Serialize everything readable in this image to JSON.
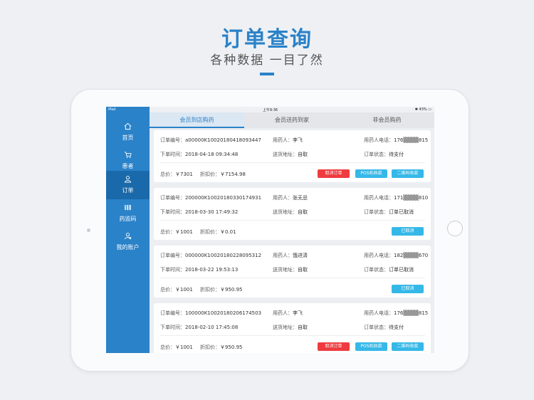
{
  "promo": {
    "title": "订单查询",
    "subtitle": "各种数据 一目了然"
  },
  "statusbar": {
    "device": "iPad",
    "time": "上午9:36",
    "battery": "43%"
  },
  "sidebar": {
    "items": [
      {
        "label": "首页",
        "icon": "home-icon",
        "active": false
      },
      {
        "label": "患者",
        "icon": "cart-icon",
        "active": false
      },
      {
        "label": "订单",
        "icon": "user-icon",
        "active": true
      },
      {
        "label": "药监码",
        "icon": "barcode-icon",
        "active": false
      },
      {
        "label": "我的账户",
        "icon": "account-icon",
        "active": false
      }
    ]
  },
  "tabs": [
    {
      "label": "会员到店购药",
      "active": true
    },
    {
      "label": "会员送药到家",
      "active": false
    },
    {
      "label": "非会员购药",
      "active": false
    }
  ],
  "labels": {
    "order_no": "订单编号：",
    "user": "用药人：",
    "phone": "用药人电话：",
    "time": "下单时间：",
    "address": "送货地址：",
    "status": "订单状态：",
    "total": "总价：",
    "discount": "折扣价："
  },
  "orders": [
    {
      "order_no": "a00000K10020180418093447",
      "user": "李飞",
      "phone": "176▒▒▒▒815",
      "time": "2018-04-18 09:34:48",
      "address": "自取",
      "status": "待支付",
      "total": "￥7301",
      "discount": "￥7154.98",
      "buttons": [
        {
          "label": "取消订单",
          "color": "red"
        },
        {
          "label": "POS机收款",
          "color": "blue"
        },
        {
          "label": "二维码收款",
          "color": "blue"
        }
      ]
    },
    {
      "order_no": "200000K10020180330174931",
      "user": "张无忌",
      "phone": "171▒▒▒▒810",
      "time": "2018-03-30 17:49:32",
      "address": "自取",
      "status": "订单已取消",
      "total": "￥1001",
      "discount": "￥0.01",
      "buttons": [
        {
          "label": "已取消",
          "color": "blue"
        }
      ]
    },
    {
      "order_no": "000000K10020180228095312",
      "user": "饿进清",
      "phone": "182▒▒▒▒670",
      "time": "2018-03-22 19:53:13",
      "address": "自取",
      "status": "订单已取消",
      "total": "￥1001",
      "discount": "￥950.95",
      "buttons": [
        {
          "label": "已取消",
          "color": "blue"
        }
      ]
    },
    {
      "order_no": "100000K10020180206174503",
      "user": "李飞",
      "phone": "176▒▒▒▒815",
      "time": "2018-02-10 17:45:08",
      "address": "自取",
      "status": "待支付",
      "total": "￥1001",
      "discount": "￥950.95",
      "buttons": [
        {
          "label": "取消订单",
          "color": "red"
        },
        {
          "label": "POS机收款",
          "color": "blue"
        },
        {
          "label": "二维码收款",
          "color": "blue"
        }
      ]
    }
  ]
}
